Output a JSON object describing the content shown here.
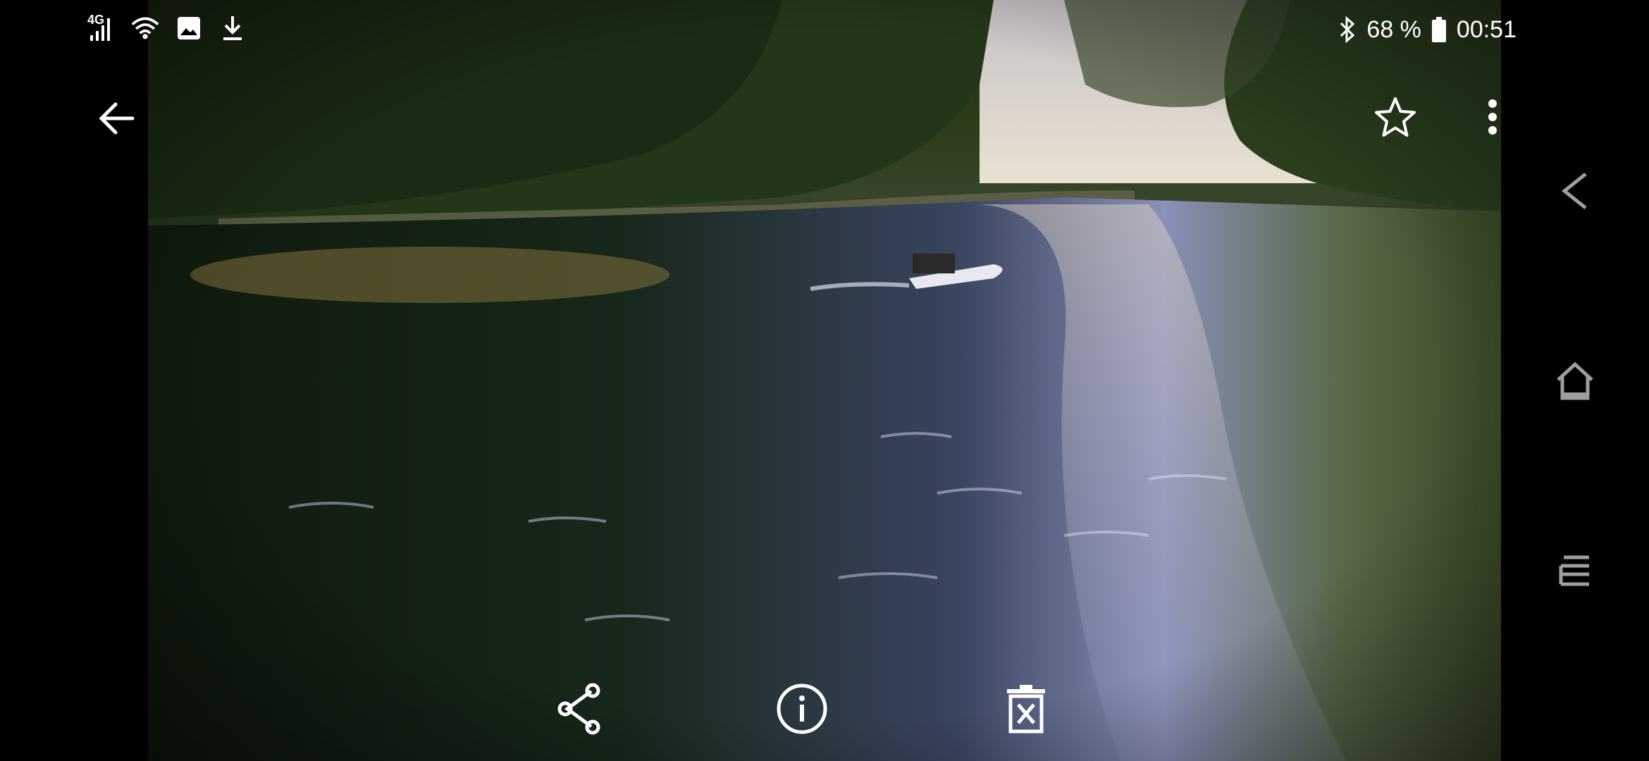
{
  "status_bar": {
    "network_type": "4G",
    "battery_percent": "68 %",
    "time": "00:51",
    "left_icons": [
      "signal-icon",
      "wifi-icon",
      "image-icon",
      "download-icon"
    ],
    "right_icons": [
      "bluetooth-icon",
      "battery-icon"
    ]
  },
  "top_bar": {
    "icons": [
      "back-arrow-icon",
      "star-icon",
      "more-vertical-icon"
    ]
  },
  "bottom_bar": {
    "icons": [
      "share-icon",
      "info-icon",
      "delete-icon"
    ]
  },
  "system_nav": {
    "icons": [
      "nav-back-icon",
      "nav-home-icon",
      "nav-recents-icon"
    ]
  },
  "photo": {
    "subject": "river-with-boat-photo"
  },
  "colors": {
    "background": "#000000",
    "icon": "#ffffff",
    "nav_icon": "#9e9e9e"
  }
}
